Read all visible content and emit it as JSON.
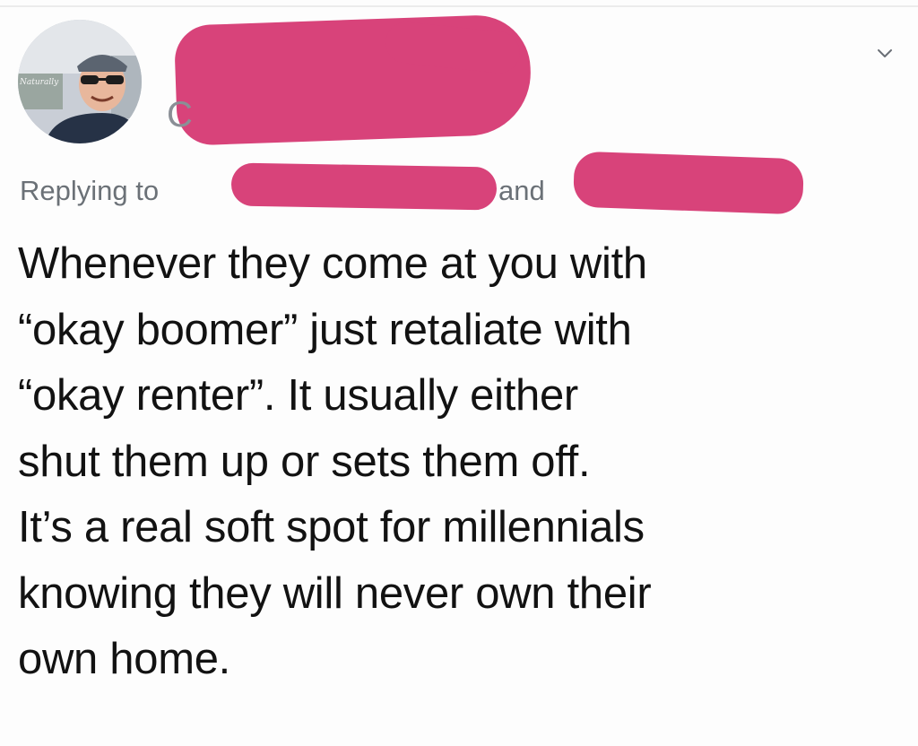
{
  "author": {
    "avatar_icon": "user-avatar-photo",
    "avatar_sign_text": "Naturally",
    "handle_fragment": "C"
  },
  "header": {
    "more_icon": "chevron-down-icon"
  },
  "reply": {
    "prefix": "Replying to",
    "conjunction": "and"
  },
  "tweet": {
    "lines": [
      "Whenever they come at you with",
      "“okay boomer” just retaliate with",
      "“okay renter”. It usually either",
      "shut them up or sets them off.",
      "It’s a real soft spot for millennials",
      "knowing they will never own their",
      "own home."
    ]
  },
  "colors": {
    "redaction": "#d8437a",
    "secondary_text": "#6b7177",
    "body_text": "#121212"
  }
}
